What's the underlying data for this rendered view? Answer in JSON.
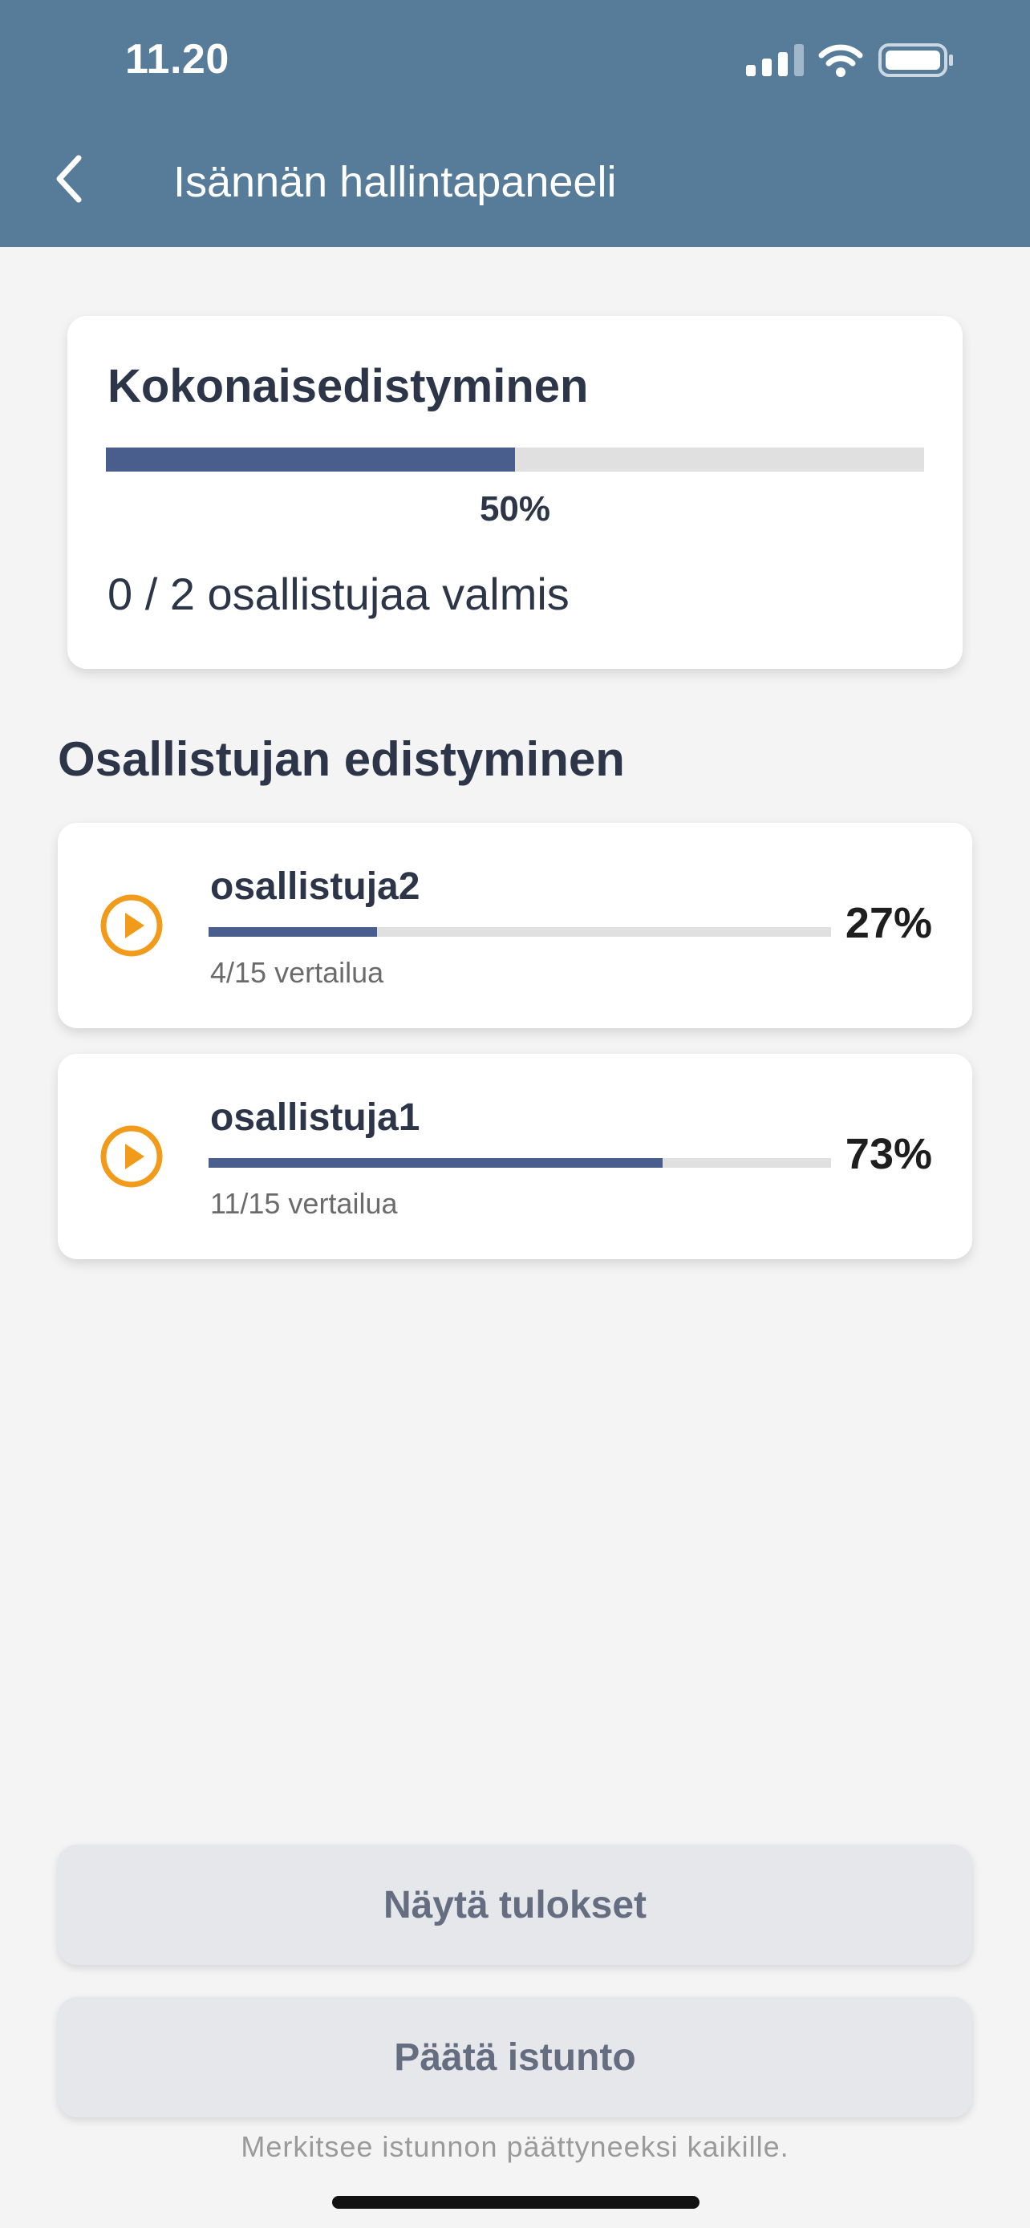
{
  "status_bar": {
    "time": "11.20"
  },
  "header": {
    "title": "Isännän hallintapaneeli"
  },
  "overall": {
    "title": "Kokonaisedistyminen",
    "progress_percent": 50,
    "progress_label": "50%",
    "completed_text": "0 / 2 osallistujaa valmis"
  },
  "section": {
    "title": "Osallistujan edistyminen"
  },
  "participants": [
    {
      "name": "osallistuja2",
      "progress_percent": 27,
      "percent_label": "27%",
      "comparisons": "4/15 vertailua"
    },
    {
      "name": "osallistuja1",
      "progress_percent": 73,
      "percent_label": "73%",
      "comparisons": "11/15 vertailua"
    }
  ],
  "buttons": {
    "show_results": "Näytä tulokset",
    "end_session": "Päätä istunto"
  },
  "footer_note": "Merkitsee istunnon päättyneeksi kaikille.",
  "colors": {
    "header": "#567c99",
    "progress_fill": "#4a5e8d",
    "play_icon": "#f29a1a"
  },
  "icons": [
    "back-chevron-icon",
    "signal-icon",
    "wifi-icon",
    "battery-icon",
    "play-circle-icon"
  ]
}
